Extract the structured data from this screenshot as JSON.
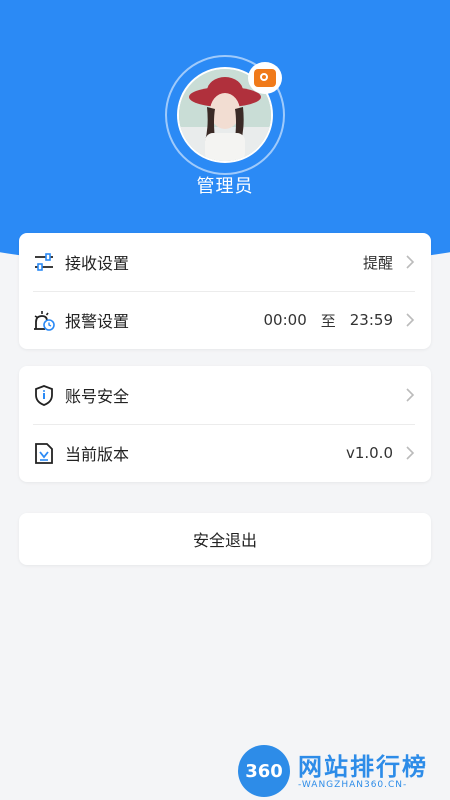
{
  "profile": {
    "username": "管理员"
  },
  "settings": {
    "receive": {
      "label": "接收设置",
      "value": "提醒"
    },
    "alarm": {
      "label": "报警设置",
      "start": "00:00",
      "to": "至",
      "end": "23:59"
    },
    "security": {
      "label": "账号安全"
    },
    "version": {
      "label": "当前版本",
      "value": "v1.0.0"
    }
  },
  "logout": {
    "label": "安全退出"
  },
  "watermark": {
    "badge": "360",
    "title": "网站排行榜",
    "subtitle": "-WANGZHAN360.CN-"
  },
  "colors": {
    "primary": "#2b8af5",
    "camera": "#f07a1a",
    "background": "#f4f5f7"
  },
  "icons": [
    "camera-icon",
    "sliders-icon",
    "alarm-clock-icon",
    "shield-icon",
    "document-icon",
    "chevron-right-icon"
  ]
}
